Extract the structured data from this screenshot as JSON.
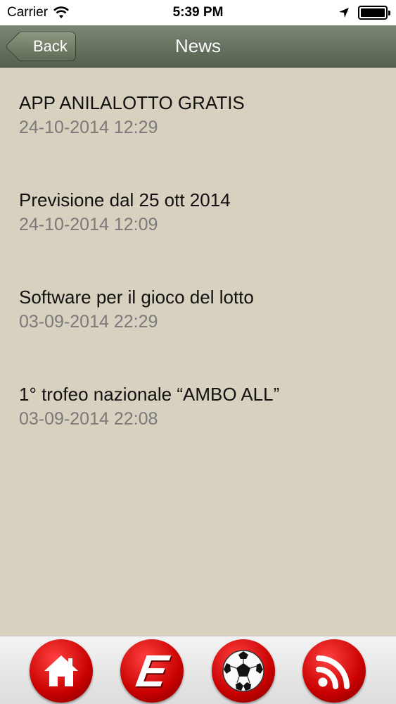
{
  "status_bar": {
    "carrier": "Carrier",
    "time": "5:39 PM"
  },
  "nav": {
    "back_label": "Back",
    "title": "News"
  },
  "news": [
    {
      "title": "APP ANILALOTTO GRATIS",
      "date": "24-10-2014 12:29"
    },
    {
      "title": "Previsione dal 25 ott 2014",
      "date": "24-10-2014 12:09"
    },
    {
      "title": "Software per il gioco del lotto",
      "date": "03-09-2014 22:29"
    },
    {
      "title": "1° trofeo nazionale “AMBO ALL”",
      "date": "03-09-2014 22:08"
    }
  ],
  "tab_bar": {
    "items": [
      {
        "icon": "home-icon"
      },
      {
        "icon": "e-logo-icon"
      },
      {
        "icon": "soccer-ball-icon"
      },
      {
        "icon": "rss-icon"
      }
    ]
  },
  "colors": {
    "background": "#d8d1c0",
    "nav_bar": "#66715e",
    "tab_button": "#d40000",
    "date_text": "#7a7a7a"
  }
}
